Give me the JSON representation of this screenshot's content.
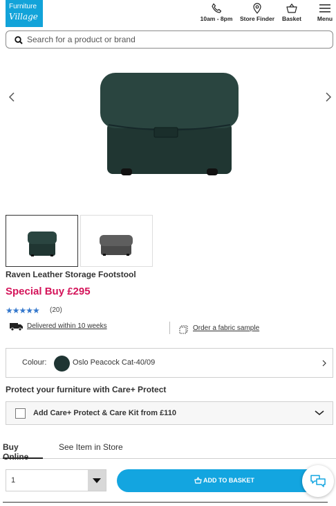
{
  "brand": {
    "logo_line1": "Furniture",
    "logo_line2": "Village",
    "color": "#12a3d9"
  },
  "header": {
    "phone_label": "10am - 8pm",
    "store_label": "Store Finder",
    "basket_label": "Basket",
    "menu_label": "Menu"
  },
  "search": {
    "placeholder": "Search for a product or brand",
    "value": ""
  },
  "product": {
    "title": "Raven Leather Storage Footstool",
    "price": "Special Buy £295",
    "rating_stars": "★★★★★",
    "rating_value": 4.5,
    "review_count": "(20)",
    "delivery_text": "Delivered within 10 weeks",
    "sample_text": "Order a fabric sample"
  },
  "colour": {
    "label": "Colour:",
    "value": "Oslo Peacock Cat-40/09",
    "swatch": "#1f3533"
  },
  "protect": {
    "heading": "Protect your furniture with Care+ Protect",
    "option_label": "Add Care+ Protect & Care Kit from £110"
  },
  "tabs": [
    {
      "label": "Buy Online",
      "active": true
    },
    {
      "label": "See Item in Store",
      "active": false
    }
  ],
  "quantity": {
    "value": "1"
  },
  "basket_button": {
    "label": "ADD TO BASKET",
    "color": "#13a5e0"
  },
  "colors": {
    "price": "#d4145a",
    "stars": "#3377cc"
  },
  "icons": [
    "phone-icon",
    "location-pin-icon",
    "basket-icon",
    "hamburger-menu-icon",
    "search-icon",
    "delivery-truck-icon",
    "fabric-sample-icon",
    "chat-icon"
  ]
}
